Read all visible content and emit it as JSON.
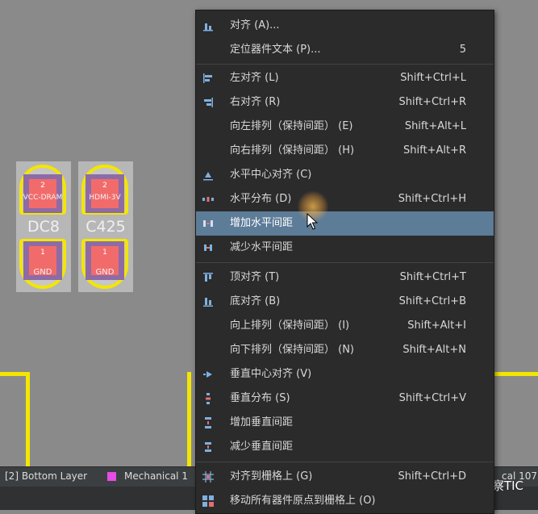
{
  "components": [
    {
      "designator": "DC8",
      "top_pad": {
        "number": "2",
        "net": "VCC-DRAM"
      },
      "bottom_pad": {
        "number": "1",
        "net": "GND"
      }
    },
    {
      "designator": "C425",
      "top_pad": {
        "number": "2",
        "net": "HDMI-3V"
      },
      "bottom_pad": {
        "number": "1",
        "net": "GND"
      }
    }
  ],
  "layer_bar": {
    "bottom_layer": "[2] Bottom Layer",
    "mechanical": "Mechanical 1",
    "mechanical_color": "#e64ce6",
    "right_tab": "cal 107"
  },
  "watermark": "掘金技术社区 @ 技术洞察TIC",
  "colors": {
    "menu_bg": "#2b2b2b",
    "highlight": "#5d7c98",
    "board_outline": "#f3e600",
    "pad": "#f26b6b"
  },
  "menu": {
    "items": [
      {
        "label": "对齐 (A)...",
        "shortcut": "",
        "icon": "align-icon"
      },
      {
        "label": "定位器件文本 (P)...",
        "shortcut": "5",
        "icon": ""
      },
      {
        "label": "左对齐 (L)",
        "shortcut": "Shift+Ctrl+L",
        "icon": "align-left-icon"
      },
      {
        "label": "右对齐 (R)",
        "shortcut": "Shift+Ctrl+R",
        "icon": "align-right-icon"
      },
      {
        "label": "向左排列（保持间距） (E)",
        "shortcut": "Shift+Alt+L",
        "icon": ""
      },
      {
        "label": "向右排列（保持间距） (H)",
        "shortcut": "Shift+Alt+R",
        "icon": ""
      },
      {
        "label": "水平中心对齐 (C)",
        "shortcut": "",
        "icon": "align-hcenter-icon"
      },
      {
        "label": "水平分布 (D)",
        "shortcut": "Shift+Ctrl+H",
        "icon": "distribute-horizontal-icon"
      },
      {
        "label": "增加水平间距",
        "shortcut": "",
        "icon": "increase-hspacing-icon"
      },
      {
        "label": "减少水平间距",
        "shortcut": "",
        "icon": "decrease-hspacing-icon"
      },
      {
        "label": "顶对齐 (T)",
        "shortcut": "Shift+Ctrl+T",
        "icon": "align-top-icon"
      },
      {
        "label": "底对齐 (B)",
        "shortcut": "Shift+Ctrl+B",
        "icon": "align-bottom-icon"
      },
      {
        "label": "向上排列（保持间距） (I)",
        "shortcut": "Shift+Alt+I",
        "icon": ""
      },
      {
        "label": "向下排列（保持间距） (N)",
        "shortcut": "Shift+Alt+N",
        "icon": ""
      },
      {
        "label": "垂直中心对齐 (V)",
        "shortcut": "",
        "icon": "align-vcenter-icon"
      },
      {
        "label": "垂直分布 (S)",
        "shortcut": "Shift+Ctrl+V",
        "icon": "distribute-vertical-icon"
      },
      {
        "label": "增加垂直间距",
        "shortcut": "",
        "icon": "increase-vspacing-icon"
      },
      {
        "label": "减少垂直间距",
        "shortcut": "",
        "icon": "decrease-vspacing-icon"
      },
      {
        "label": "对齐到栅格上 (G)",
        "shortcut": "Shift+Ctrl+D",
        "icon": "align-to-grid-icon"
      },
      {
        "label": "移动所有器件原点到栅格上 (O)",
        "shortcut": "",
        "icon": "move-origins-to-grid-icon"
      }
    ]
  }
}
